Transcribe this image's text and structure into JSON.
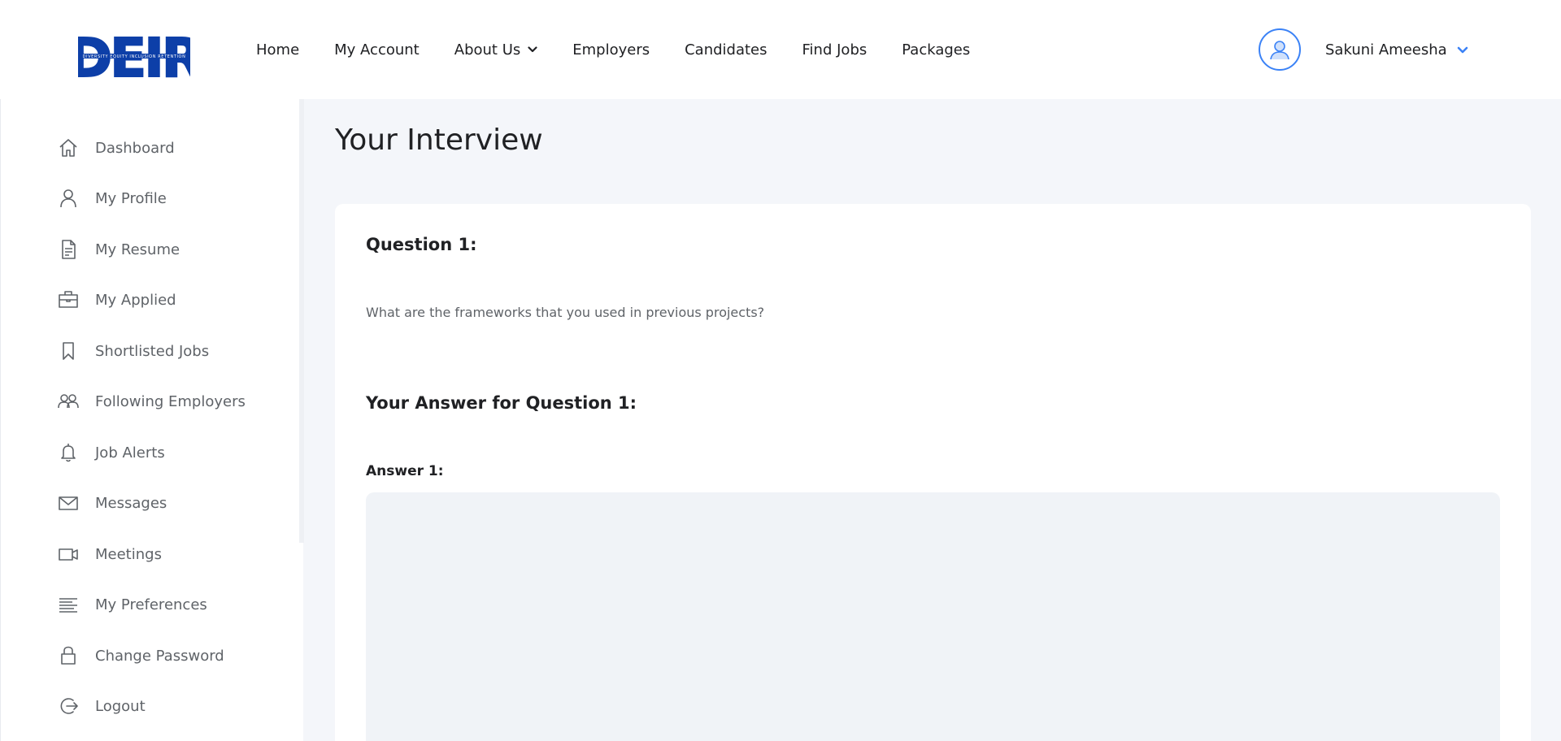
{
  "header": {
    "logo_text": "DEIR",
    "logo_tagline": "DIVERSITY EQUITY INCLUSION RETENTION",
    "nav": [
      {
        "label": "Home"
      },
      {
        "label": "My Account"
      },
      {
        "label": "About Us",
        "has_dropdown": true
      },
      {
        "label": "Employers"
      },
      {
        "label": "Candidates"
      },
      {
        "label": "Find Jobs"
      },
      {
        "label": "Packages"
      }
    ],
    "user_name": "Sakuni Ameesha",
    "accent_color": "#3b82f6",
    "logo_color": "#0d3fa8"
  },
  "sidebar": {
    "items": [
      {
        "label": "Dashboard",
        "icon": "home-icon"
      },
      {
        "label": "My Profile",
        "icon": "user-icon"
      },
      {
        "label": "My Resume",
        "icon": "document-icon"
      },
      {
        "label": "My Applied",
        "icon": "briefcase-icon"
      },
      {
        "label": "Shortlisted Jobs",
        "icon": "bookmark-icon"
      },
      {
        "label": "Following Employers",
        "icon": "users-icon"
      },
      {
        "label": "Job Alerts",
        "icon": "bell-icon"
      },
      {
        "label": "Messages",
        "icon": "mail-icon"
      },
      {
        "label": "Meetings",
        "icon": "video-icon"
      },
      {
        "label": "My Preferences",
        "icon": "lines-icon"
      },
      {
        "label": "Change Password",
        "icon": "lock-icon"
      },
      {
        "label": "Logout",
        "icon": "logout-icon"
      }
    ]
  },
  "main": {
    "title": "Your Interview",
    "question_title": "Question 1:",
    "question_text": "What are the frameworks that you used in previous projects?",
    "answer_title": "Your Answer for Question 1:",
    "answer_label": "Answer 1:",
    "answer_value": ""
  }
}
